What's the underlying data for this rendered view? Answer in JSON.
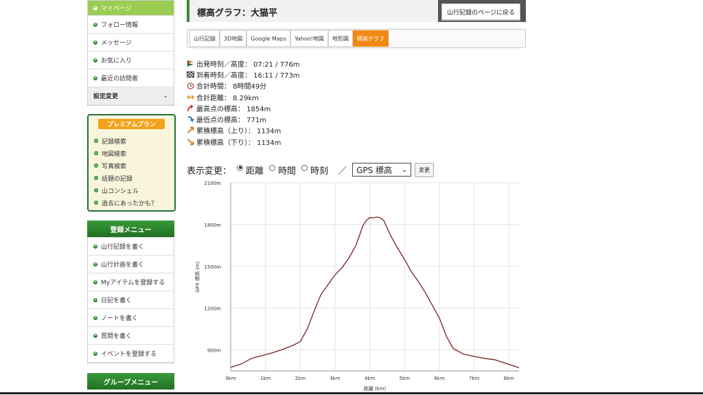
{
  "sidebar": {
    "menu": [
      {
        "label": "マイページ",
        "active": true
      },
      {
        "label": "フォロー情報"
      },
      {
        "label": "メッセージ"
      },
      {
        "label": "お気に入り"
      },
      {
        "label": "最近の訪問者"
      }
    ],
    "settings_label": "設定変更",
    "premium": {
      "title": "プレミアムプラン",
      "items": [
        "記録検索",
        "地図検索",
        "写真検索",
        "話題の記録",
        "山コンシェル",
        "過去にあったかも？"
      ]
    },
    "register": {
      "title": "登録メニュー",
      "items": [
        "山行記録を書く",
        "山行計画を書く",
        "Myアイテムを登録する",
        "日記を書く",
        "ノートを書く",
        "質問を書く",
        "イベントを登録する"
      ]
    },
    "group_title": "グループメニュー"
  },
  "header": {
    "title": "標高グラフ：大猫平",
    "back_button": "山行記録のページに戻る"
  },
  "tabs": [
    {
      "label": "山行記録"
    },
    {
      "label": "3D地図"
    },
    {
      "label": "Google Maps"
    },
    {
      "label": "Yahoo!地図"
    },
    {
      "label": "地形図"
    },
    {
      "label": "標高グラフ",
      "active": true
    }
  ],
  "stats": [
    {
      "icon": "start-flag-icon",
      "label": "出発時刻／高度： 07:21 / 776m"
    },
    {
      "icon": "goal-flag-icon",
      "label": "到着時刻／高度： 16:11 / 773m"
    },
    {
      "icon": "clock-icon",
      "label": "合計時間： 8時間49分"
    },
    {
      "icon": "distance-arrow-icon",
      "label": "合計距離： 8.29km"
    },
    {
      "icon": "highest-arrow-icon",
      "label": "最高点の標高： 1854m"
    },
    {
      "icon": "lowest-arrow-icon",
      "label": "最低点の標高： 771m"
    },
    {
      "icon": "ascent-arrow-icon",
      "label": "累積標高（上り）： 1134m"
    },
    {
      "icon": "descent-arrow-icon",
      "label": "累積標高（下り）： 1134m"
    }
  ],
  "controls": {
    "label": "表示変更：",
    "options": [
      "距離",
      "時間",
      "時刻"
    ],
    "selected": 0,
    "separator": "／",
    "select_value": "GPS 標高",
    "button": "変更"
  },
  "colors": {
    "accent_green": "#2e8b2e",
    "tab_active": "#f08a14",
    "line": "#7a1f1f"
  },
  "chart_data": {
    "type": "line",
    "xlabel": "距離 (km)",
    "ylabel": "GPX 標高 (m)",
    "xlim": [
      0,
      8.29
    ],
    "ylim": [
      750,
      2100
    ],
    "x_ticks": [
      0,
      1,
      2,
      3,
      4,
      5,
      6,
      7,
      8
    ],
    "x_tick_labels": [
      "0km",
      "1km",
      "2km",
      "3km",
      "4km",
      "5km",
      "6km",
      "7km",
      "8km"
    ],
    "y_ticks": [
      900,
      1200,
      1500,
      1800,
      2100
    ],
    "y_tick_labels": [
      "900m",
      "1200m",
      "1500m",
      "1800m",
      "2100m"
    ],
    "grid": true,
    "series": [
      {
        "x": [
          0,
          0.3,
          0.6,
          0.9,
          1.2,
          1.5,
          1.8,
          2.0,
          2.2,
          2.4,
          2.6,
          2.8,
          3.0,
          3.2,
          3.4,
          3.6,
          3.7,
          3.8,
          3.9,
          4.0,
          4.1,
          4.2,
          4.3,
          4.4,
          4.6,
          4.8,
          5.0,
          5.2,
          5.4,
          5.6,
          5.8,
          6.0,
          6.2,
          6.4,
          6.7,
          7.0,
          7.3,
          7.6,
          7.9,
          8.29
        ],
        "values": [
          776,
          800,
          840,
          860,
          880,
          905,
          935,
          960,
          1050,
          1180,
          1300,
          1370,
          1440,
          1490,
          1560,
          1650,
          1720,
          1790,
          1830,
          1850,
          1848,
          1854,
          1848,
          1830,
          1720,
          1630,
          1550,
          1460,
          1390,
          1310,
          1220,
          1130,
          1000,
          910,
          870,
          855,
          840,
          830,
          805,
          773
        ]
      }
    ]
  }
}
